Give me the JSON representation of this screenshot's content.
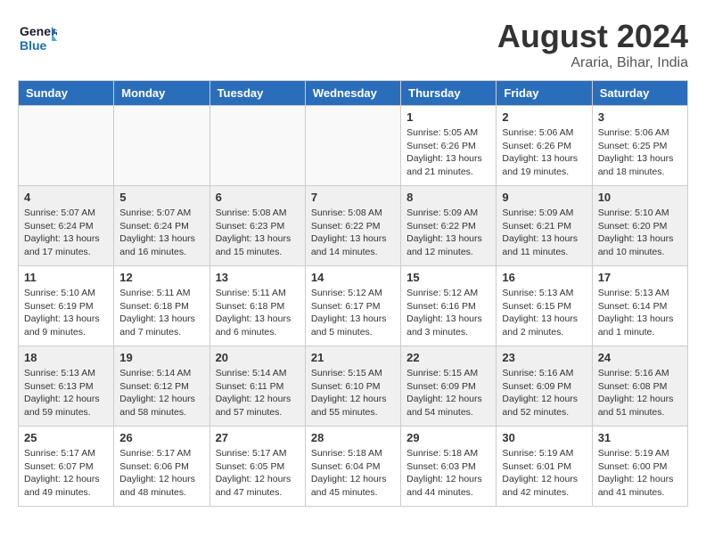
{
  "header": {
    "logo_general": "General",
    "logo_blue": "Blue",
    "month_year": "August 2024",
    "location": "Araria, Bihar, India"
  },
  "weekdays": [
    "Sunday",
    "Monday",
    "Tuesday",
    "Wednesday",
    "Thursday",
    "Friday",
    "Saturday"
  ],
  "weeks": [
    [
      {
        "day": "",
        "info": ""
      },
      {
        "day": "",
        "info": ""
      },
      {
        "day": "",
        "info": ""
      },
      {
        "day": "",
        "info": ""
      },
      {
        "day": "1",
        "info": "Sunrise: 5:05 AM\nSunset: 6:26 PM\nDaylight: 13 hours\nand 21 minutes."
      },
      {
        "day": "2",
        "info": "Sunrise: 5:06 AM\nSunset: 6:26 PM\nDaylight: 13 hours\nand 19 minutes."
      },
      {
        "day": "3",
        "info": "Sunrise: 5:06 AM\nSunset: 6:25 PM\nDaylight: 13 hours\nand 18 minutes."
      }
    ],
    [
      {
        "day": "4",
        "info": "Sunrise: 5:07 AM\nSunset: 6:24 PM\nDaylight: 13 hours\nand 17 minutes."
      },
      {
        "day": "5",
        "info": "Sunrise: 5:07 AM\nSunset: 6:24 PM\nDaylight: 13 hours\nand 16 minutes."
      },
      {
        "day": "6",
        "info": "Sunrise: 5:08 AM\nSunset: 6:23 PM\nDaylight: 13 hours\nand 15 minutes."
      },
      {
        "day": "7",
        "info": "Sunrise: 5:08 AM\nSunset: 6:22 PM\nDaylight: 13 hours\nand 14 minutes."
      },
      {
        "day": "8",
        "info": "Sunrise: 5:09 AM\nSunset: 6:22 PM\nDaylight: 13 hours\nand 12 minutes."
      },
      {
        "day": "9",
        "info": "Sunrise: 5:09 AM\nSunset: 6:21 PM\nDaylight: 13 hours\nand 11 minutes."
      },
      {
        "day": "10",
        "info": "Sunrise: 5:10 AM\nSunset: 6:20 PM\nDaylight: 13 hours\nand 10 minutes."
      }
    ],
    [
      {
        "day": "11",
        "info": "Sunrise: 5:10 AM\nSunset: 6:19 PM\nDaylight: 13 hours\nand 9 minutes."
      },
      {
        "day": "12",
        "info": "Sunrise: 5:11 AM\nSunset: 6:18 PM\nDaylight: 13 hours\nand 7 minutes."
      },
      {
        "day": "13",
        "info": "Sunrise: 5:11 AM\nSunset: 6:18 PM\nDaylight: 13 hours\nand 6 minutes."
      },
      {
        "day": "14",
        "info": "Sunrise: 5:12 AM\nSunset: 6:17 PM\nDaylight: 13 hours\nand 5 minutes."
      },
      {
        "day": "15",
        "info": "Sunrise: 5:12 AM\nSunset: 6:16 PM\nDaylight: 13 hours\nand 3 minutes."
      },
      {
        "day": "16",
        "info": "Sunrise: 5:13 AM\nSunset: 6:15 PM\nDaylight: 13 hours\nand 2 minutes."
      },
      {
        "day": "17",
        "info": "Sunrise: 5:13 AM\nSunset: 6:14 PM\nDaylight: 13 hours\nand 1 minute."
      }
    ],
    [
      {
        "day": "18",
        "info": "Sunrise: 5:13 AM\nSunset: 6:13 PM\nDaylight: 12 hours\nand 59 minutes."
      },
      {
        "day": "19",
        "info": "Sunrise: 5:14 AM\nSunset: 6:12 PM\nDaylight: 12 hours\nand 58 minutes."
      },
      {
        "day": "20",
        "info": "Sunrise: 5:14 AM\nSunset: 6:11 PM\nDaylight: 12 hours\nand 57 minutes."
      },
      {
        "day": "21",
        "info": "Sunrise: 5:15 AM\nSunset: 6:10 PM\nDaylight: 12 hours\nand 55 minutes."
      },
      {
        "day": "22",
        "info": "Sunrise: 5:15 AM\nSunset: 6:09 PM\nDaylight: 12 hours\nand 54 minutes."
      },
      {
        "day": "23",
        "info": "Sunrise: 5:16 AM\nSunset: 6:09 PM\nDaylight: 12 hours\nand 52 minutes."
      },
      {
        "day": "24",
        "info": "Sunrise: 5:16 AM\nSunset: 6:08 PM\nDaylight: 12 hours\nand 51 minutes."
      }
    ],
    [
      {
        "day": "25",
        "info": "Sunrise: 5:17 AM\nSunset: 6:07 PM\nDaylight: 12 hours\nand 49 minutes."
      },
      {
        "day": "26",
        "info": "Sunrise: 5:17 AM\nSunset: 6:06 PM\nDaylight: 12 hours\nand 48 minutes."
      },
      {
        "day": "27",
        "info": "Sunrise: 5:17 AM\nSunset: 6:05 PM\nDaylight: 12 hours\nand 47 minutes."
      },
      {
        "day": "28",
        "info": "Sunrise: 5:18 AM\nSunset: 6:04 PM\nDaylight: 12 hours\nand 45 minutes."
      },
      {
        "day": "29",
        "info": "Sunrise: 5:18 AM\nSunset: 6:03 PM\nDaylight: 12 hours\nand 44 minutes."
      },
      {
        "day": "30",
        "info": "Sunrise: 5:19 AM\nSunset: 6:01 PM\nDaylight: 12 hours\nand 42 minutes."
      },
      {
        "day": "31",
        "info": "Sunrise: 5:19 AM\nSunset: 6:00 PM\nDaylight: 12 hours\nand 41 minutes."
      }
    ]
  ]
}
